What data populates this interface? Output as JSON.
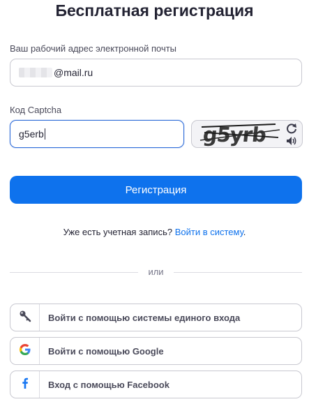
{
  "page": {
    "title": "Бесплатная регистрация"
  },
  "email": {
    "label": "Ваш рабочий адрес электронной почты",
    "value_suffix": "@mail.ru"
  },
  "captcha": {
    "label": "Код Captcha",
    "input_value": "g5erb",
    "image_text": "g5yrb",
    "refresh_icon": "refresh-icon",
    "audio_icon": "speaker-icon"
  },
  "register": {
    "button_label": "Регистрация"
  },
  "signin": {
    "prompt": "Уже есть учетная запись?",
    "link_label": "Войти в систему",
    "suffix": "."
  },
  "divider": {
    "text": "или"
  },
  "social": {
    "sso_label": "Войти с помощью системы единого входа",
    "google_label": "Войти с помощью Google",
    "facebook_label": "Вход с помощью Facebook"
  },
  "colors": {
    "accent": "#0e72ed",
    "focus_border": "#2d6bd8",
    "text": "#232333",
    "facebook": "#1877f2"
  }
}
